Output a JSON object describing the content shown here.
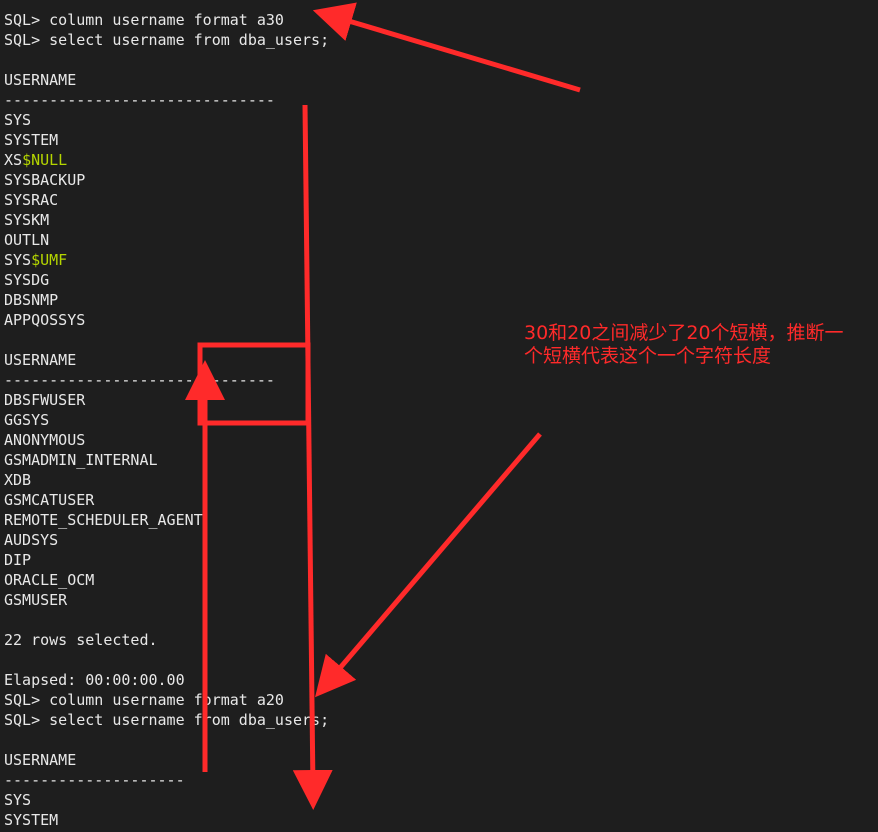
{
  "terminal": {
    "lines": [
      {
        "text": "SQL> column username format a30"
      },
      {
        "text": "SQL> select username from dba_users;"
      },
      {
        "text": ""
      },
      {
        "text": "USERNAME"
      },
      {
        "text": "------------------------------"
      },
      {
        "text": "SYS"
      },
      {
        "text": "SYSTEM"
      },
      {
        "text": "XS",
        "hl": "$NULL"
      },
      {
        "text": "SYSBACKUP"
      },
      {
        "text": "SYSRAC"
      },
      {
        "text": "SYSKM"
      },
      {
        "text": "OUTLN"
      },
      {
        "text": "SYS",
        "hl": "$UMF"
      },
      {
        "text": "SYSDG"
      },
      {
        "text": "DBSNMP"
      },
      {
        "text": "APPQOSSYS"
      },
      {
        "text": ""
      },
      {
        "text": "USERNAME"
      },
      {
        "text": "------------------------------"
      },
      {
        "text": "DBSFWUSER"
      },
      {
        "text": "GGSYS"
      },
      {
        "text": "ANONYMOUS"
      },
      {
        "text": "GSMADMIN_INTERNAL"
      },
      {
        "text": "XDB"
      },
      {
        "text": "GSMCATUSER"
      },
      {
        "text": "REMOTE_SCHEDULER_AGENT"
      },
      {
        "text": "AUDSYS"
      },
      {
        "text": "DIP"
      },
      {
        "text": "ORACLE_OCM"
      },
      {
        "text": "GSMUSER"
      },
      {
        "text": ""
      },
      {
        "text": "22 rows selected."
      },
      {
        "text": ""
      },
      {
        "text": "Elapsed: 00:00:00.00"
      },
      {
        "text": "SQL> column username format a20"
      },
      {
        "text": "SQL> select username from dba_users;"
      },
      {
        "text": ""
      },
      {
        "text": "USERNAME"
      },
      {
        "text": "--------------------"
      },
      {
        "text": "SYS"
      },
      {
        "text": "SYSTEM"
      }
    ]
  },
  "annotation": {
    "note": "30和20之间减少了20个短横，推断一个短横代表这个一个字符长度",
    "color": "#ff2a2a"
  },
  "colors": {
    "background": "#1e1e1e",
    "text": "#e8e8e8",
    "highlight": "#b5d600"
  }
}
